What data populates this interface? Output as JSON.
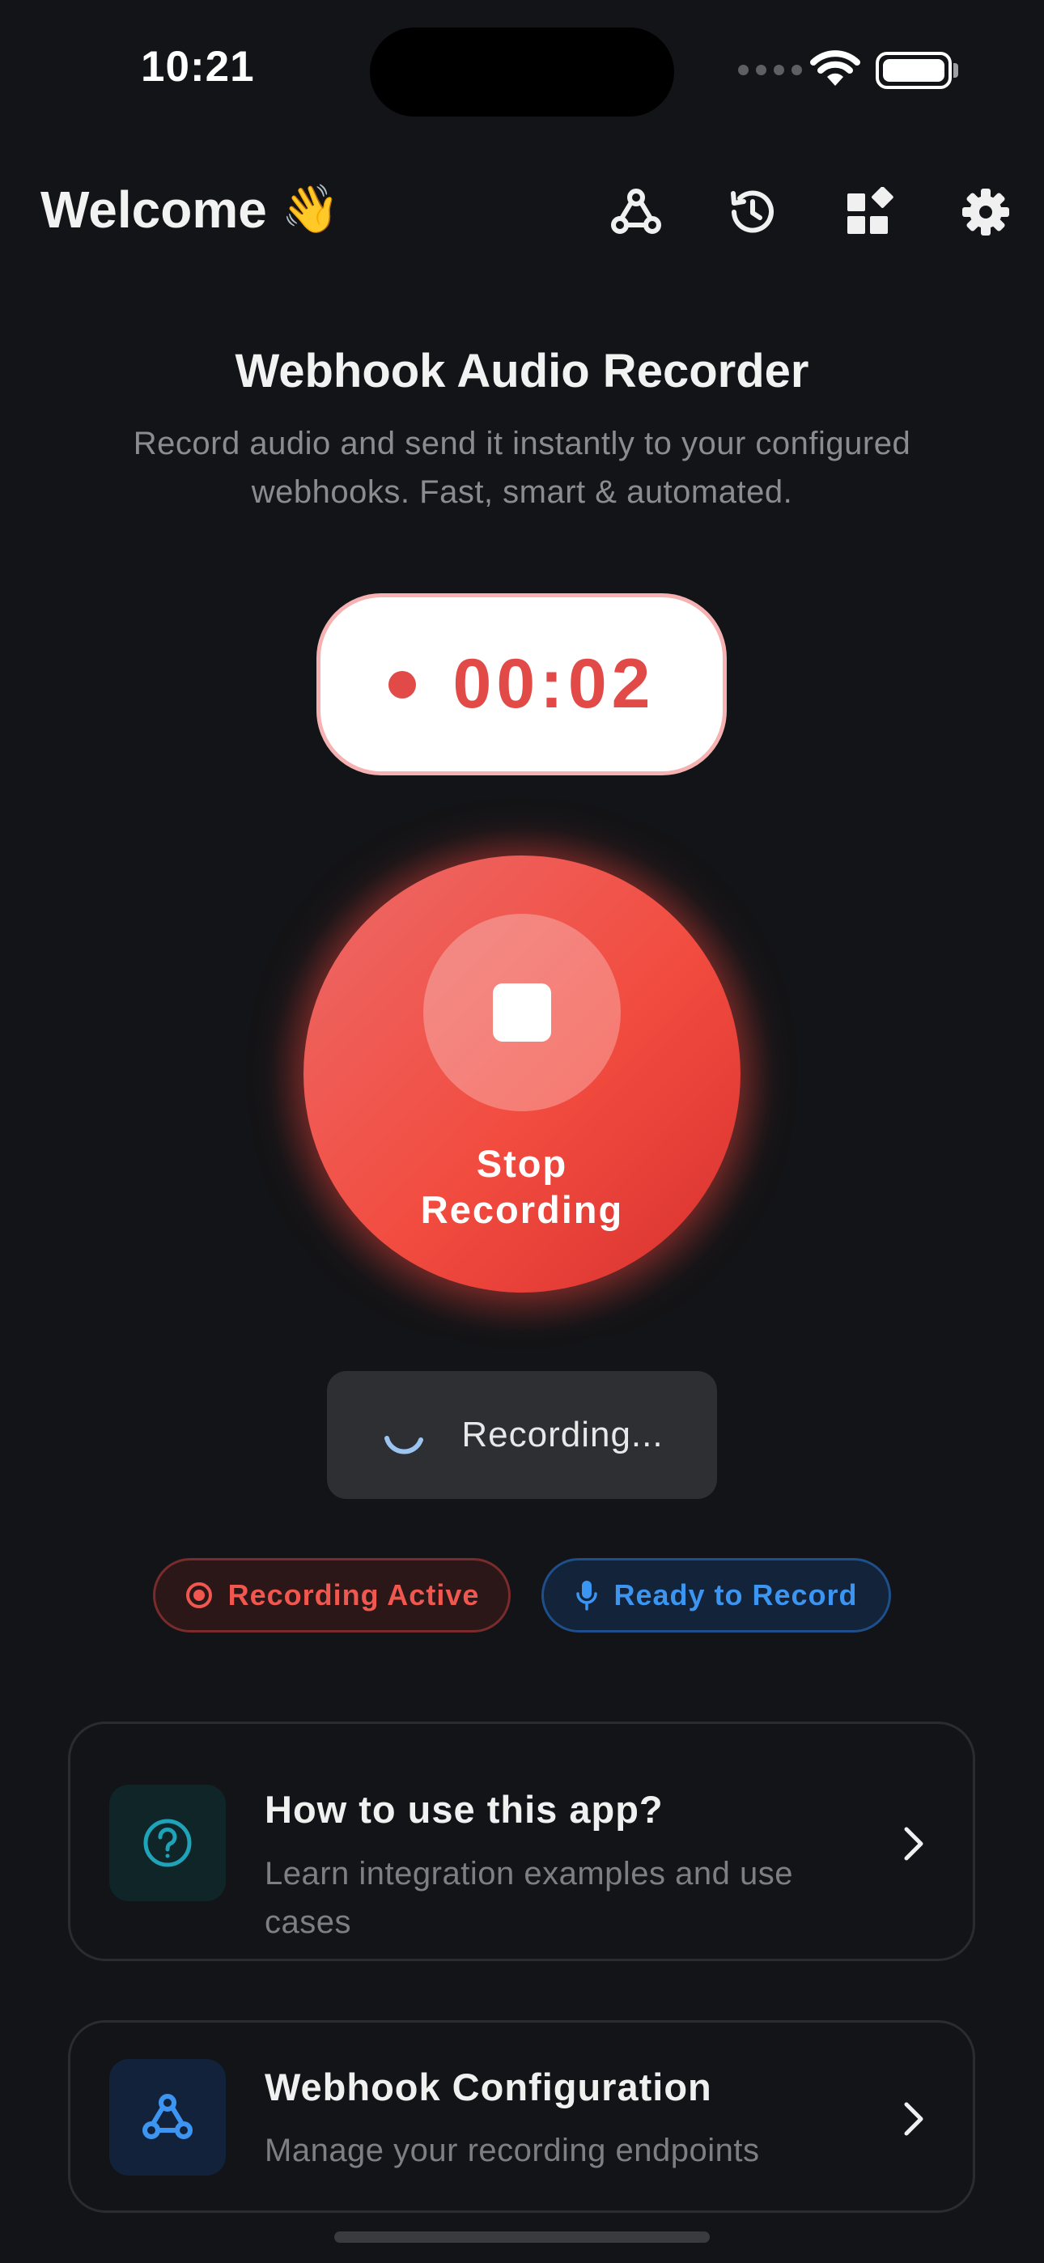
{
  "status_bar": {
    "time": "10:21"
  },
  "header": {
    "welcome": "Welcome",
    "wave_emoji": "👋",
    "icons": [
      "webhook-icon",
      "history-icon",
      "widgets-icon",
      "settings-icon"
    ]
  },
  "hero": {
    "title": "Webhook Audio Recorder",
    "subtitle": "Record audio and send it instantly to your configured webhooks. Fast, smart & automated."
  },
  "timer": {
    "elapsed": "00:02"
  },
  "record_button": {
    "label": "Stop\nRecording"
  },
  "recording_pill": {
    "label": "Recording..."
  },
  "badges": {
    "active": "Recording Active",
    "ready": "Ready to Record"
  },
  "cards": {
    "how_to": {
      "title": "How to use this app?",
      "description": "Learn integration examples and use cases"
    },
    "webhook_config": {
      "title": "Webhook Configuration",
      "description": "Manage your recording endpoints"
    }
  },
  "colors": {
    "background": "#131417",
    "accent_red": "#e24a47",
    "accent_blue": "#3c95f0",
    "teal": "#1fa3b8"
  }
}
